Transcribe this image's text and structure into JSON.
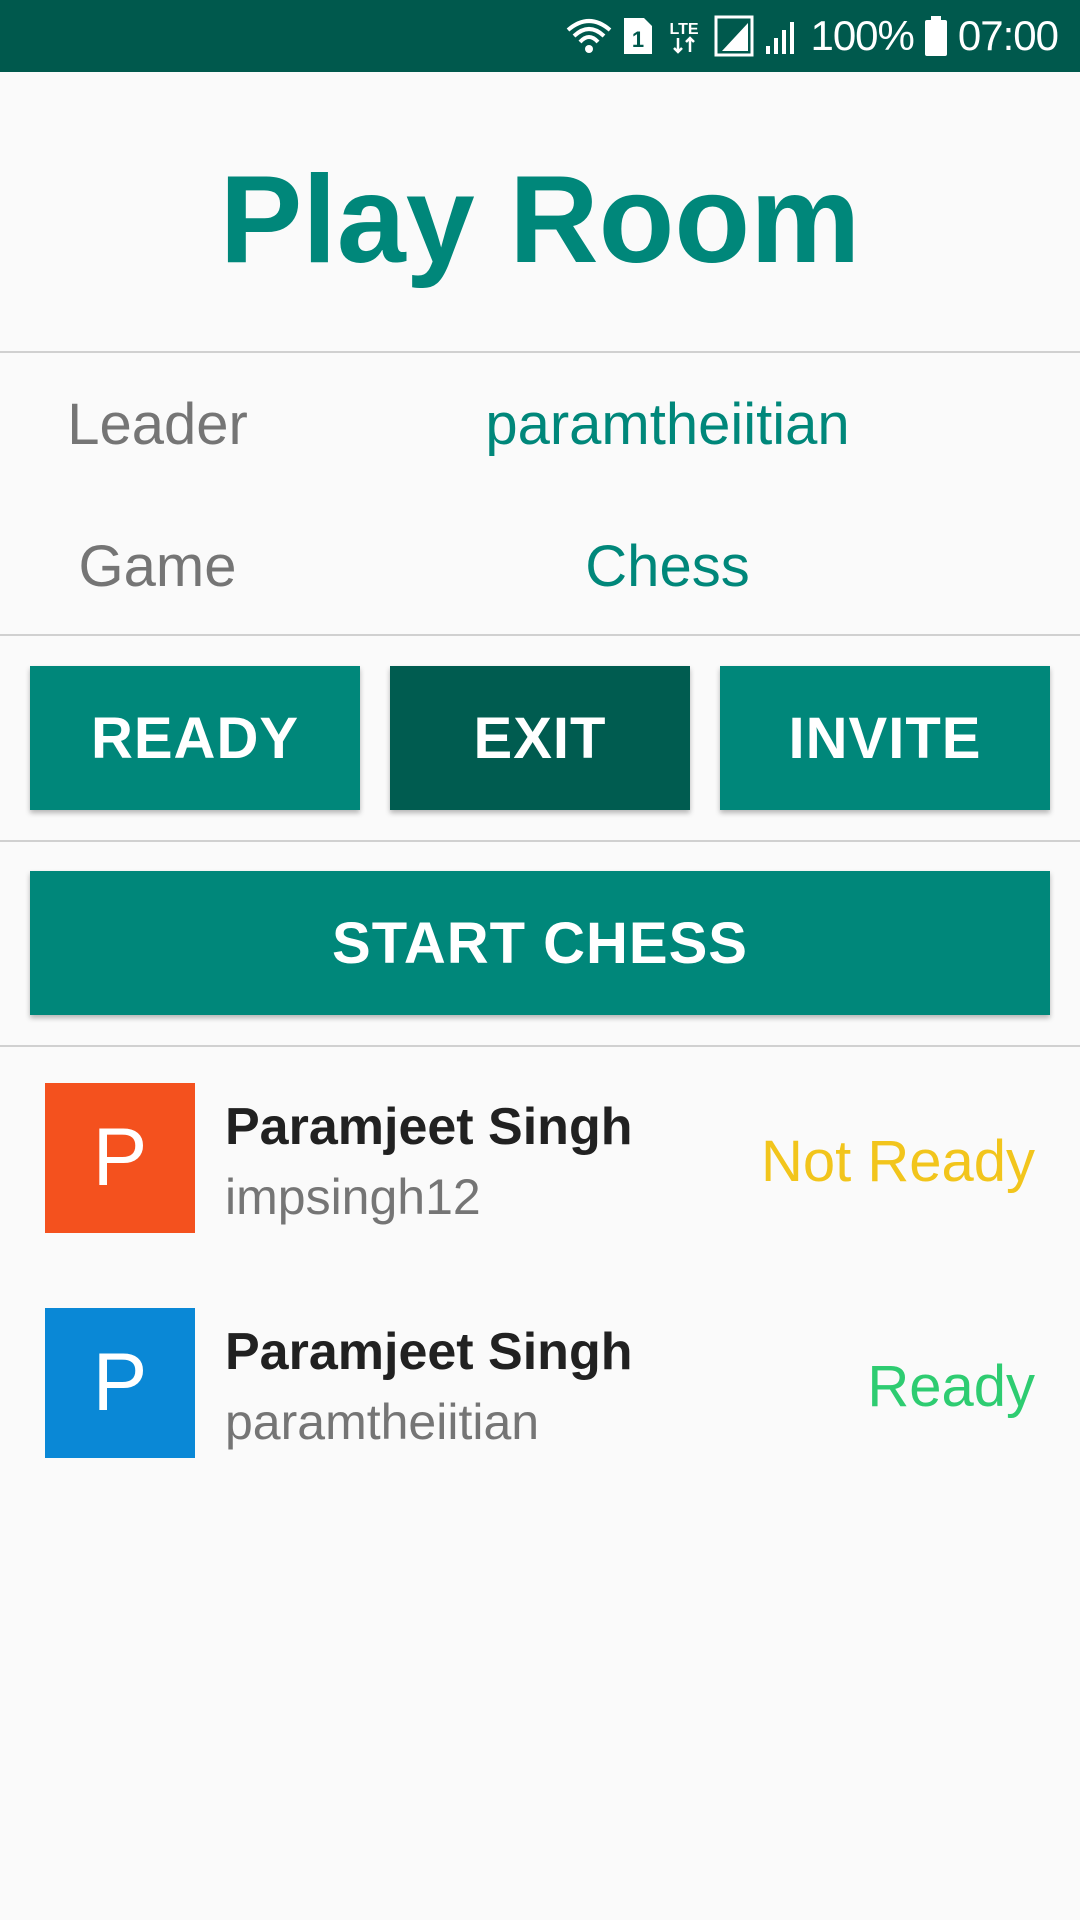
{
  "status_bar": {
    "battery": "100%",
    "time": "07:00",
    "sim_badge": "1",
    "network": "LTE"
  },
  "header": {
    "title": "Play Room"
  },
  "room_info": {
    "leader_label": "Leader",
    "leader_value": "paramtheiitian",
    "game_label": "Game",
    "game_value": "Chess"
  },
  "actions": {
    "ready_label": "READY",
    "exit_label": "EXIT",
    "invite_label": "INVITE",
    "start_label": "START CHESS"
  },
  "players": [
    {
      "initial": "P",
      "name": "Paramjeet Singh",
      "username": "impsingh12",
      "status": "Not Ready",
      "avatar_color": "#f4511e",
      "status_color": "#f2c51c"
    },
    {
      "initial": "P",
      "name": "Paramjeet Singh",
      "username": "paramtheiitian",
      "status": "Ready",
      "avatar_color": "#0a88d6",
      "status_color": "#2ecc71"
    }
  ],
  "colors": {
    "accent": "#00877a",
    "accent_dark": "#005c50",
    "status_bar": "#00594d"
  },
  "icons": [
    "wifi-icon",
    "sim-icon",
    "lte-icon",
    "signal-icon",
    "battery-icon"
  ]
}
